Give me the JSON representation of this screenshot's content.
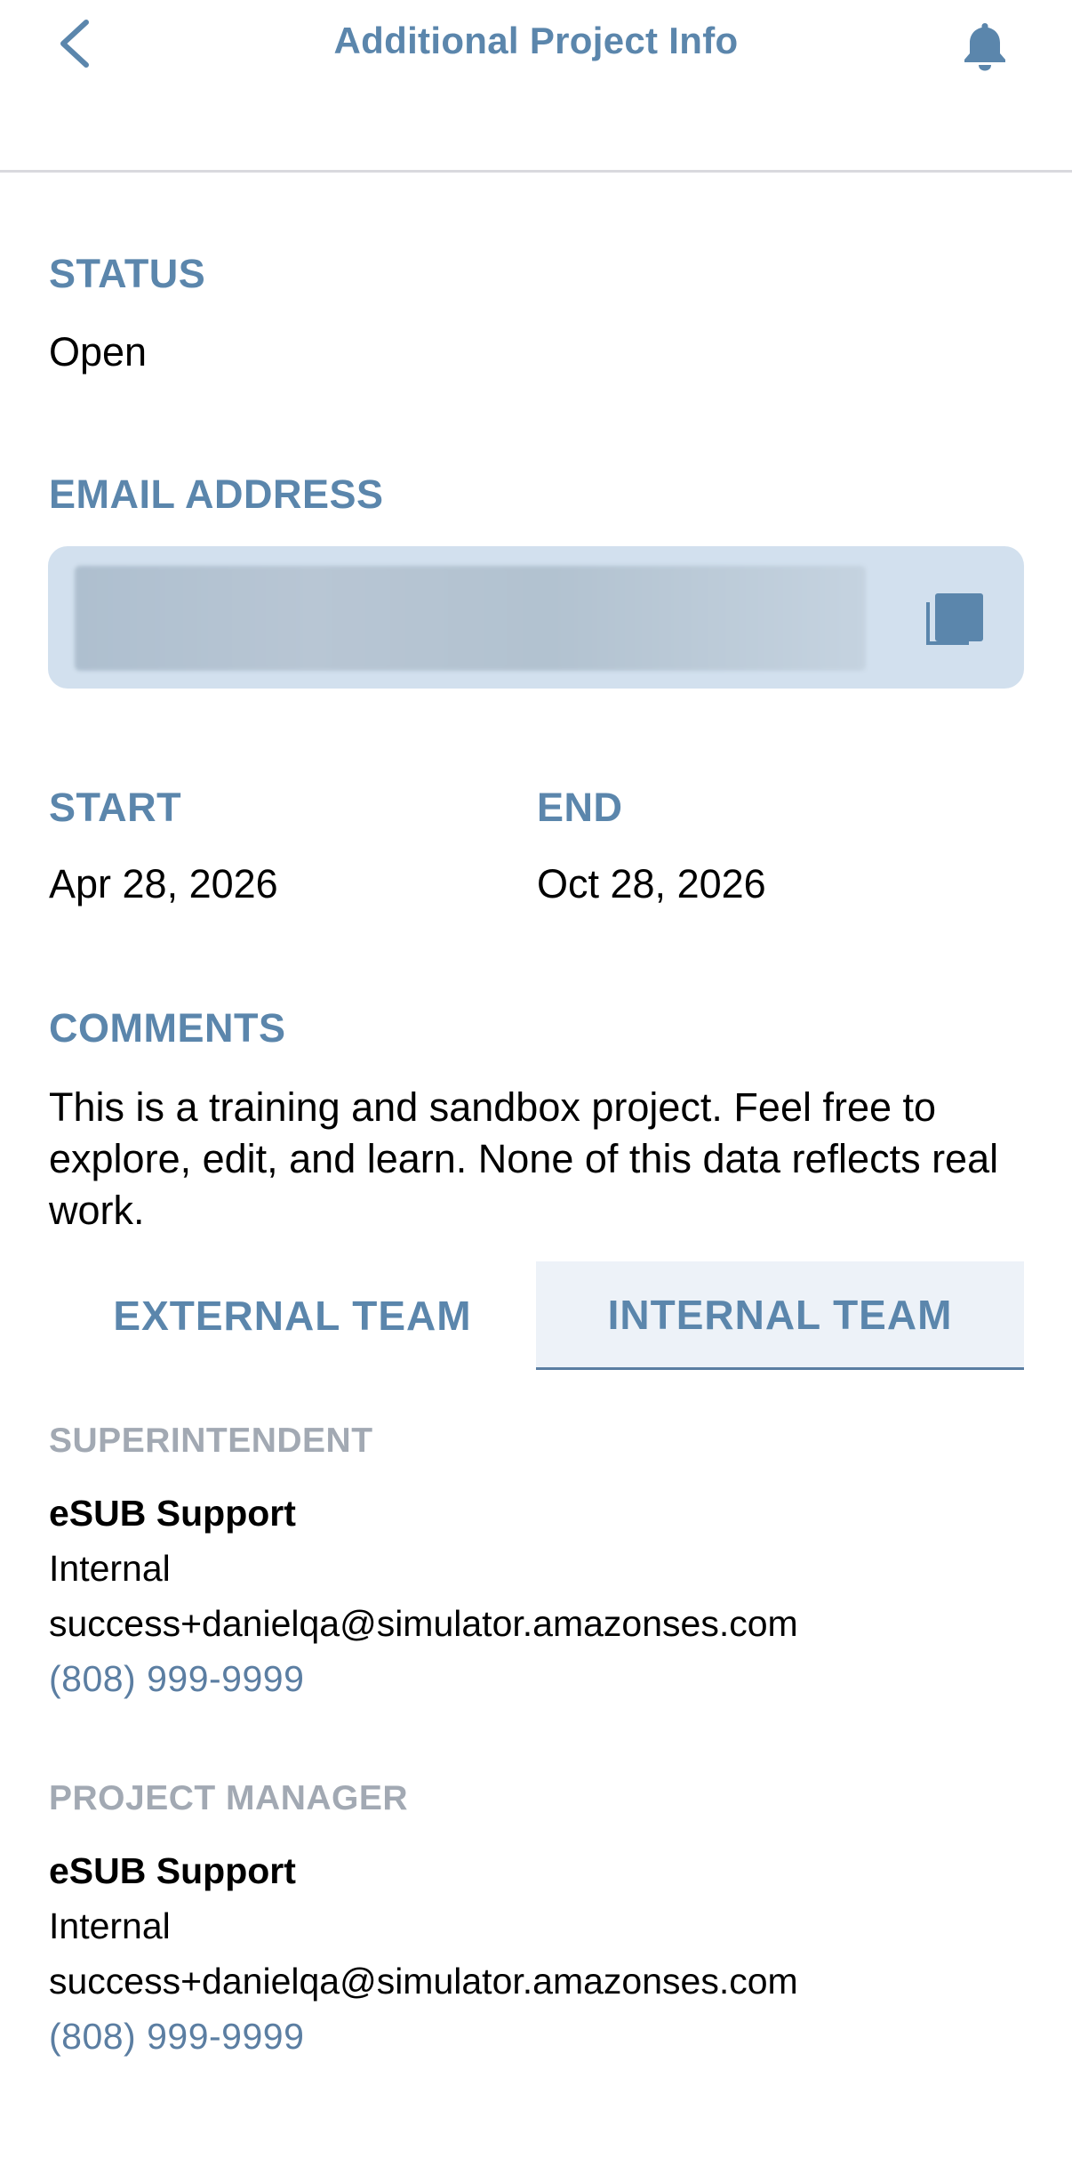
{
  "header": {
    "title": "Additional Project Info",
    "back_icon": "chevron-left-icon",
    "bell_icon": "bell-icon"
  },
  "status": {
    "label": "STATUS",
    "value": "Open"
  },
  "email": {
    "label": "EMAIL ADDRESS",
    "copy_icon": "copy-icon"
  },
  "dates": {
    "start_label": "START",
    "start_value": "Apr 28, 2026",
    "end_label": "END",
    "end_value": "Oct 28, 2026"
  },
  "comments": {
    "label": "COMMENTS",
    "text": "This is a training and sandbox project. Feel free to explore, edit, and learn. None of this data reflects real work."
  },
  "tabs": [
    {
      "label": "EXTERNAL TEAM",
      "selected": false
    },
    {
      "label": "INTERNAL TEAM",
      "selected": true
    }
  ],
  "contacts": [
    {
      "role": "SUPERINTENDENT",
      "name": "eSUB Support",
      "type": "Internal",
      "email": "success+danielqa@simulator.amazonses.com",
      "phone": "(808) 999-9999"
    },
    {
      "role": "PROJECT MANAGER",
      "name": "eSUB Support",
      "type": "Internal",
      "email": "success+danielqa@simulator.amazonses.com",
      "phone": "(808) 999-9999"
    }
  ],
  "colors": {
    "accent": "#5b86ac",
    "muted_label": "#a2a9b3",
    "email_box_bg": "#d2e0ee",
    "selected_tab_bg": "#edf2f8"
  }
}
